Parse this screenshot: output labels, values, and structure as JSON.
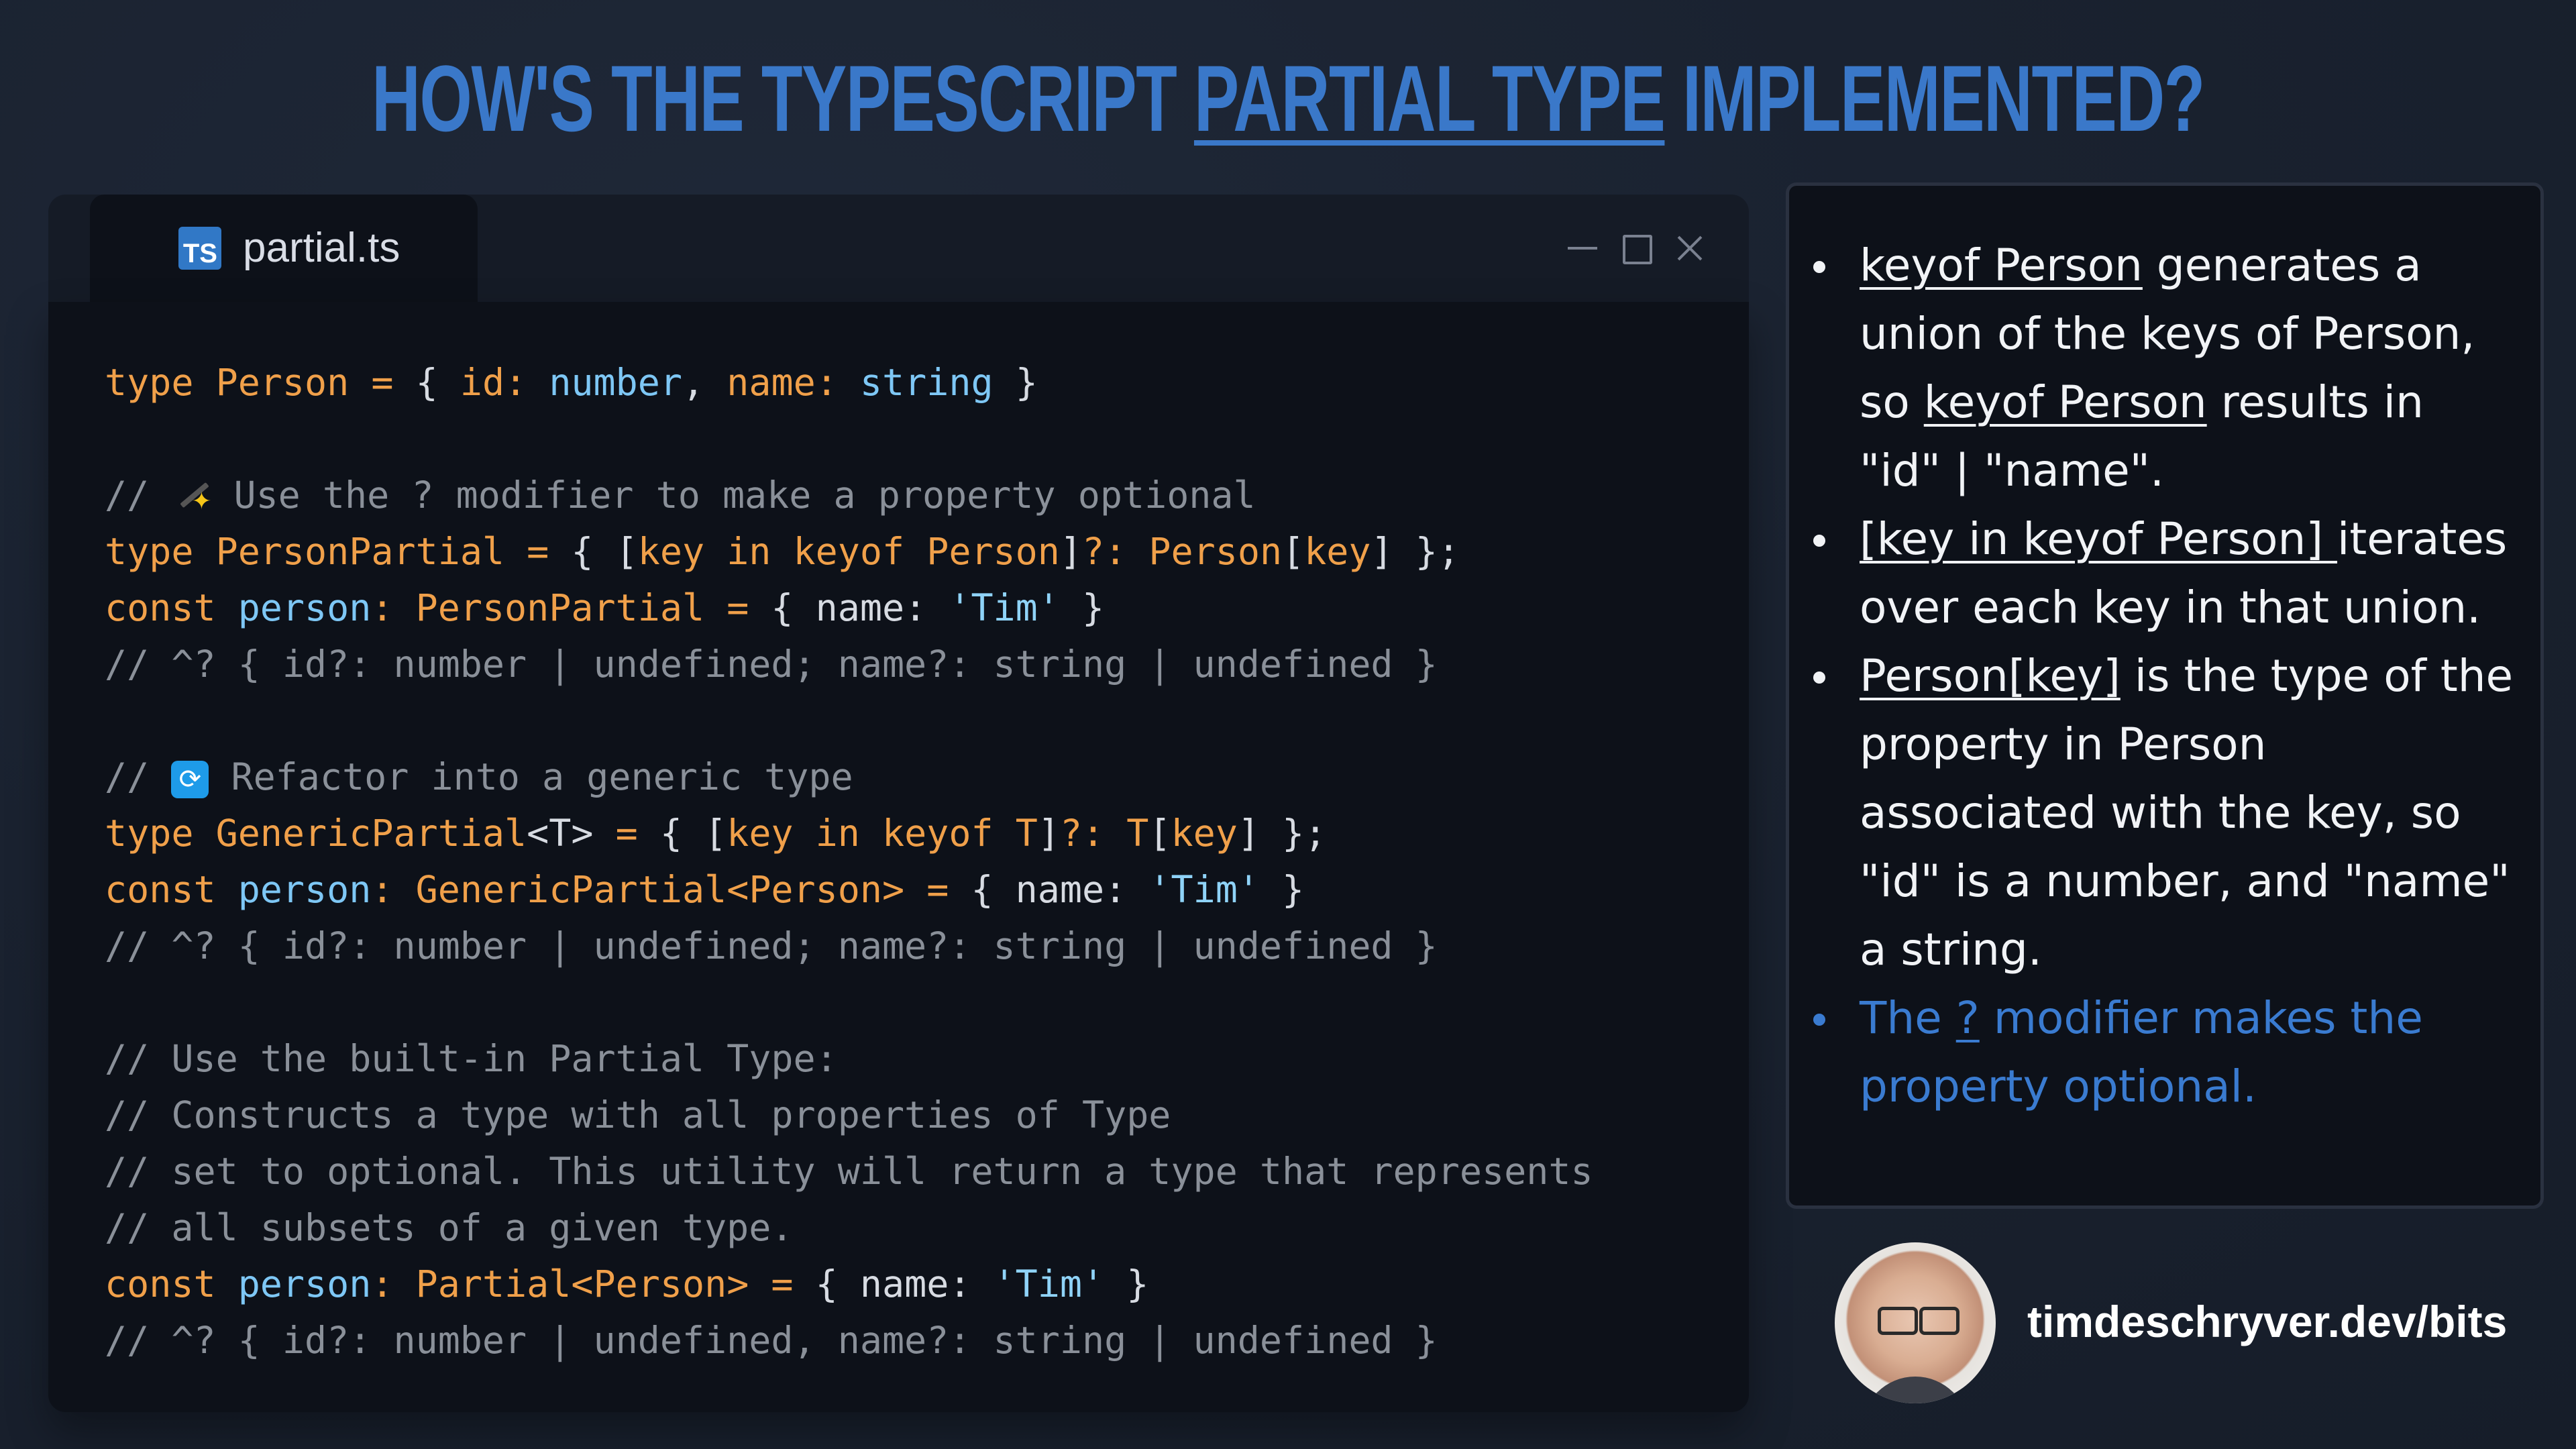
{
  "title": {
    "part1": "How's the TypeScript ",
    "part2": "Partial type",
    "part3": " implemented?"
  },
  "editor": {
    "tab_label": "partial.ts",
    "tab_icon": "TS",
    "window_controls": [
      "minimize-icon",
      "maximize-icon",
      "close-icon"
    ]
  },
  "code": {
    "l1": {
      "a": "type ",
      "b": "Person",
      "c": " = ",
      "d": "{ ",
      "e": "id",
      "f": ": ",
      "g": "number",
      "h": ", ",
      "i": "name",
      "j": ": ",
      "k": "string",
      "l": " }"
    },
    "l3": {
      "pre": "// ",
      "post": " Use the ? modifier to make a property optional"
    },
    "l4": {
      "a": "type ",
      "b": "PersonPartial",
      "c": " = ",
      "d": "{ [",
      "e": "key",
      "f": " in ",
      "g": "keyof ",
      "h": "Person",
      "i": "]",
      "j": "?:",
      "k": " Person",
      "l": "[",
      "m": "key",
      "n": "] };"
    },
    "l5": {
      "a": "const ",
      "b": "person",
      "c": ": ",
      "d": "PersonPartial",
      "e": " = ",
      "f": "{ name: ",
      "g": "'Tim'",
      "h": " }"
    },
    "l6": "// ^? { id?: number | undefined; name?: string | undefined }",
    "l8": {
      "pre": "// ",
      "post": " Refactor into a generic type"
    },
    "l9": {
      "a": "type ",
      "b": "GenericPartial",
      "c": "<T>",
      "d": " = ",
      "e": "{ [",
      "f": "key",
      "g": " in ",
      "h": "keyof ",
      "i": "T",
      "j": "]",
      "k": "?:",
      "l": " T",
      "m": "[",
      "n": "key",
      "o": "] };"
    },
    "l10": {
      "a": "const ",
      "b": "person",
      "c": ": ",
      "d": "GenericPartial",
      "e": "<Person>",
      "f": " = ",
      "g": "{ name: ",
      "h": "'Tim'",
      "i": " }"
    },
    "l11": "// ^? { id?: number | undefined; name?: string | undefined }",
    "l13": "// Use the built-in Partial Type:",
    "l14": "// Constructs a type with all properties of Type",
    "l15": "// set to optional. This utility will return a type that represents",
    "l16": "// all subsets of a given type.",
    "l17": {
      "a": "const ",
      "b": "person",
      "c": ": ",
      "d": "Partial",
      "e": "<Person>",
      "f": " = ",
      "g": "{ name: ",
      "h": "'Tim'",
      "i": " }"
    },
    "l18": "// ^? { id?: number | undefined, name?: string | undefined }"
  },
  "notes": {
    "b1": {
      "u1": "keyof Person",
      "t1": " generates a union of the keys of Person, so ",
      "u2": "keyof Person",
      "t2": " results in \"id\" | \"name\"."
    },
    "b2": {
      "u1": "[key in keyof Person] ",
      "t1": " iterates over each key in that union."
    },
    "b3": {
      "u1": "Person[key]",
      "t1": " is the type of the property in Person associated with the key, so \"id\" is a number, and \"name\" a string."
    },
    "b4": {
      "t0": "The ",
      "u1": "?",
      "t1": " modifier makes the property optional."
    }
  },
  "author": {
    "handle": "timdeschryver.dev/bits"
  },
  "colors": {
    "title": "#3a78c9",
    "keyword": "#f0a04a",
    "identifier": "#7ec7f5",
    "comment": "#8a9099",
    "highlight_bullet": "#3a7bd0"
  }
}
